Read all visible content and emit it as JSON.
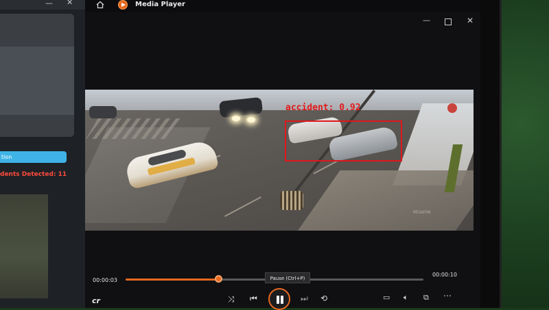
{
  "left_app": {
    "button_label": "tion",
    "status_text": "dents Detected: 11"
  },
  "player": {
    "title": "Media Player",
    "overlay": {
      "label": "accident: 0.92",
      "color": "#e0161c"
    },
    "watermark": "MEGAFON",
    "controls": {
      "current_time": "00:00:03",
      "total_time": "00:00:10",
      "progress": 0.31,
      "tooltip": "Pause (Ctrl+P)",
      "captions_label": "cr"
    },
    "accent_color": "#e8681e",
    "icons": [
      "home-icon",
      "app-logo-icon",
      "minimize-icon",
      "maximize-icon",
      "close-icon",
      "shuffle-icon",
      "previous-icon",
      "pause-icon",
      "next-icon",
      "repeat-icon",
      "miniplayer-icon",
      "volume-icon",
      "cast-icon",
      "more-icon"
    ]
  }
}
